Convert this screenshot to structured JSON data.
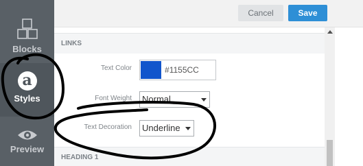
{
  "sidebar": {
    "items": [
      {
        "label": "Blocks",
        "icon": "blocks-icon"
      },
      {
        "label": "Styles",
        "icon": "styles-icon",
        "icon_glyph": "a",
        "active": true
      },
      {
        "label": "Preview",
        "icon": "eye-icon"
      }
    ]
  },
  "toolbar": {
    "cancel_label": "Cancel",
    "save_label": "Save"
  },
  "sections": {
    "links": {
      "title": "LINKS",
      "text_color": {
        "label": "Text Color",
        "value": "#1155CC",
        "hex_display": "1155CC",
        "hash": "#"
      },
      "font_weight": {
        "label": "Font Weight",
        "value": "Normal"
      },
      "text_decoration": {
        "label": "Text Decoration",
        "value": "Underline"
      }
    },
    "heading1": {
      "title": "HEADING 1"
    }
  },
  "colors": {
    "sidebar_bg": "#596066",
    "save_button": "#2e8fd6",
    "link_swatch": "#1155CC",
    "annotation_ink": "#000000"
  }
}
